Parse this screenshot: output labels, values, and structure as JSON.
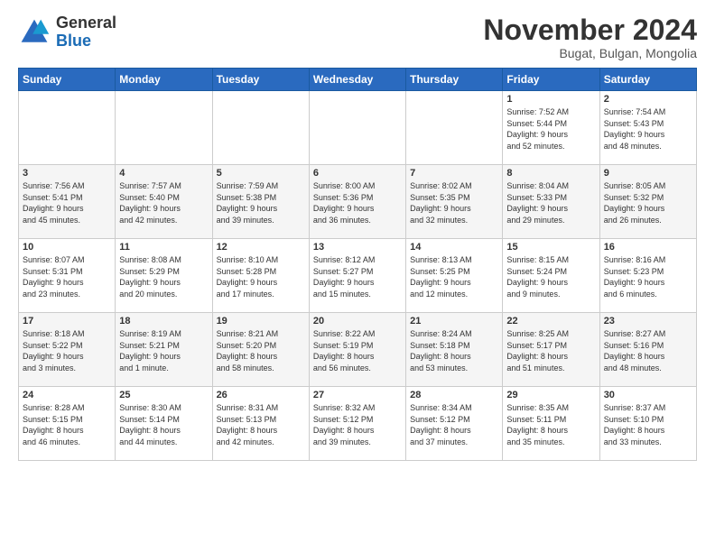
{
  "header": {
    "logo": {
      "general": "General",
      "blue": "Blue"
    },
    "title": "November 2024",
    "location": "Bugat, Bulgan, Mongolia"
  },
  "calendar": {
    "days_of_week": [
      "Sunday",
      "Monday",
      "Tuesday",
      "Wednesday",
      "Thursday",
      "Friday",
      "Saturday"
    ],
    "weeks": [
      [
        {
          "day": "",
          "info": ""
        },
        {
          "day": "",
          "info": ""
        },
        {
          "day": "",
          "info": ""
        },
        {
          "day": "",
          "info": ""
        },
        {
          "day": "",
          "info": ""
        },
        {
          "day": "1",
          "info": "Sunrise: 7:52 AM\nSunset: 5:44 PM\nDaylight: 9 hours\nand 52 minutes."
        },
        {
          "day": "2",
          "info": "Sunrise: 7:54 AM\nSunset: 5:43 PM\nDaylight: 9 hours\nand 48 minutes."
        }
      ],
      [
        {
          "day": "3",
          "info": "Sunrise: 7:56 AM\nSunset: 5:41 PM\nDaylight: 9 hours\nand 45 minutes."
        },
        {
          "day": "4",
          "info": "Sunrise: 7:57 AM\nSunset: 5:40 PM\nDaylight: 9 hours\nand 42 minutes."
        },
        {
          "day": "5",
          "info": "Sunrise: 7:59 AM\nSunset: 5:38 PM\nDaylight: 9 hours\nand 39 minutes."
        },
        {
          "day": "6",
          "info": "Sunrise: 8:00 AM\nSunset: 5:36 PM\nDaylight: 9 hours\nand 36 minutes."
        },
        {
          "day": "7",
          "info": "Sunrise: 8:02 AM\nSunset: 5:35 PM\nDaylight: 9 hours\nand 32 minutes."
        },
        {
          "day": "8",
          "info": "Sunrise: 8:04 AM\nSunset: 5:33 PM\nDaylight: 9 hours\nand 29 minutes."
        },
        {
          "day": "9",
          "info": "Sunrise: 8:05 AM\nSunset: 5:32 PM\nDaylight: 9 hours\nand 26 minutes."
        }
      ],
      [
        {
          "day": "10",
          "info": "Sunrise: 8:07 AM\nSunset: 5:31 PM\nDaylight: 9 hours\nand 23 minutes."
        },
        {
          "day": "11",
          "info": "Sunrise: 8:08 AM\nSunset: 5:29 PM\nDaylight: 9 hours\nand 20 minutes."
        },
        {
          "day": "12",
          "info": "Sunrise: 8:10 AM\nSunset: 5:28 PM\nDaylight: 9 hours\nand 17 minutes."
        },
        {
          "day": "13",
          "info": "Sunrise: 8:12 AM\nSunset: 5:27 PM\nDaylight: 9 hours\nand 15 minutes."
        },
        {
          "day": "14",
          "info": "Sunrise: 8:13 AM\nSunset: 5:25 PM\nDaylight: 9 hours\nand 12 minutes."
        },
        {
          "day": "15",
          "info": "Sunrise: 8:15 AM\nSunset: 5:24 PM\nDaylight: 9 hours\nand 9 minutes."
        },
        {
          "day": "16",
          "info": "Sunrise: 8:16 AM\nSunset: 5:23 PM\nDaylight: 9 hours\nand 6 minutes."
        }
      ],
      [
        {
          "day": "17",
          "info": "Sunrise: 8:18 AM\nSunset: 5:22 PM\nDaylight: 9 hours\nand 3 minutes."
        },
        {
          "day": "18",
          "info": "Sunrise: 8:19 AM\nSunset: 5:21 PM\nDaylight: 9 hours\nand 1 minute."
        },
        {
          "day": "19",
          "info": "Sunrise: 8:21 AM\nSunset: 5:20 PM\nDaylight: 8 hours\nand 58 minutes."
        },
        {
          "day": "20",
          "info": "Sunrise: 8:22 AM\nSunset: 5:19 PM\nDaylight: 8 hours\nand 56 minutes."
        },
        {
          "day": "21",
          "info": "Sunrise: 8:24 AM\nSunset: 5:18 PM\nDaylight: 8 hours\nand 53 minutes."
        },
        {
          "day": "22",
          "info": "Sunrise: 8:25 AM\nSunset: 5:17 PM\nDaylight: 8 hours\nand 51 minutes."
        },
        {
          "day": "23",
          "info": "Sunrise: 8:27 AM\nSunset: 5:16 PM\nDaylight: 8 hours\nand 48 minutes."
        }
      ],
      [
        {
          "day": "24",
          "info": "Sunrise: 8:28 AM\nSunset: 5:15 PM\nDaylight: 8 hours\nand 46 minutes."
        },
        {
          "day": "25",
          "info": "Sunrise: 8:30 AM\nSunset: 5:14 PM\nDaylight: 8 hours\nand 44 minutes."
        },
        {
          "day": "26",
          "info": "Sunrise: 8:31 AM\nSunset: 5:13 PM\nDaylight: 8 hours\nand 42 minutes."
        },
        {
          "day": "27",
          "info": "Sunrise: 8:32 AM\nSunset: 5:12 PM\nDaylight: 8 hours\nand 39 minutes."
        },
        {
          "day": "28",
          "info": "Sunrise: 8:34 AM\nSunset: 5:12 PM\nDaylight: 8 hours\nand 37 minutes."
        },
        {
          "day": "29",
          "info": "Sunrise: 8:35 AM\nSunset: 5:11 PM\nDaylight: 8 hours\nand 35 minutes."
        },
        {
          "day": "30",
          "info": "Sunrise: 8:37 AM\nSunset: 5:10 PM\nDaylight: 8 hours\nand 33 minutes."
        }
      ]
    ]
  }
}
